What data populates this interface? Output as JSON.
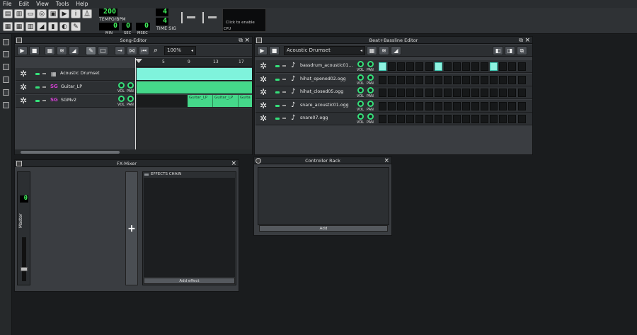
{
  "menu": [
    "File",
    "Edit",
    "View",
    "Tools",
    "Help"
  ],
  "toolbar": {
    "tempo_value": "200",
    "tempo_label": "TEMPO/BPM",
    "time_min": "0",
    "time_sec": "0",
    "time_msec": "0",
    "min_label": "MIN",
    "sec_label": "SEC",
    "msec_label": "MSEC",
    "timesig_num": "4",
    "timesig_den": "4",
    "timesig_label": "TIME SIG",
    "cpu_text": "Click to enable",
    "cpu_label": "CPU"
  },
  "song_editor": {
    "title": "Song-Editor",
    "zoom": "100%",
    "bar_labels": [
      "5",
      "9",
      "13",
      "17"
    ],
    "tracks": [
      {
        "name": "Acoustic Drumset"
      },
      {
        "name": "Guitar_LP"
      },
      {
        "name": "SGMv2"
      }
    ],
    "vol_label": "VOL",
    "pan_label": "PAN",
    "pattern_labels": [
      "Guitar_LP",
      "Guitar_LP",
      "Guita"
    ]
  },
  "bb_editor": {
    "title": "Beat+Bassline Editor",
    "kit": "Acoustic Drumset",
    "vol_label": "VOL",
    "pan_label": "PAN",
    "rows": [
      {
        "name": "bassdrum_acoustic01...",
        "steps": [
          1,
          0,
          0,
          0,
          0,
          0,
          1,
          0,
          0,
          0,
          0,
          0,
          1,
          0,
          0,
          0
        ]
      },
      {
        "name": "hihat_opened02.ogg",
        "steps": [
          0,
          0,
          0,
          0,
          0,
          0,
          0,
          0,
          0,
          0,
          0,
          0,
          0,
          0,
          0,
          0
        ]
      },
      {
        "name": "hihat_closed05.ogg",
        "steps": [
          0,
          0,
          0,
          0,
          0,
          0,
          0,
          0,
          0,
          0,
          0,
          0,
          0,
          0,
          0,
          0
        ]
      },
      {
        "name": "snare_acoustic01.ogg",
        "steps": [
          0,
          0,
          0,
          0,
          0,
          0,
          0,
          0,
          0,
          0,
          0,
          0,
          0,
          0,
          0,
          0
        ]
      },
      {
        "name": "snare07.ogg",
        "steps": [
          0,
          0,
          0,
          0,
          0,
          0,
          0,
          0,
          0,
          0,
          0,
          0,
          0,
          0,
          0,
          0
        ]
      }
    ]
  },
  "fx_mixer": {
    "title": "FX-Mixer",
    "master_value": "0",
    "master_label": "Master",
    "effects_chain": "EFFECTS CHAIN",
    "add_effect": "Add effect",
    "add_channel": "+"
  },
  "controller_rack": {
    "title": "Controller Rack",
    "add": "Add"
  },
  "colors": {
    "accent": "#35e07a",
    "step_on": "#8ef3e0",
    "pattern": "#45d88a"
  }
}
